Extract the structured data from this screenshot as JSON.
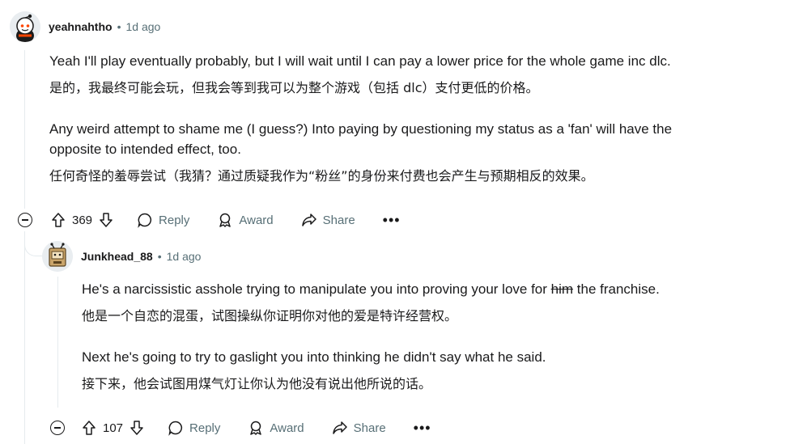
{
  "comments": [
    {
      "username": "yeahnahtho",
      "separator": "•",
      "time": "1d ago",
      "paragraphs": [
        "Yeah I'll play eventually probably, but I will wait until I can pay a lower price for the whole game inc dlc.",
        "是的，我最终可能会玩，但我会等到我可以为整个游戏（包括 dlc）支付更低的价格。",
        "Any weird attempt to shame me (I guess?) Into paying by questioning my status as a 'fan' will have the",
        "opposite to intended effect, too.",
        "任何奇怪的羞辱尝试（我猜？通过质疑我作为“粉丝”的身份来付费也会产生与预期相反的效果。"
      ],
      "votes": "369",
      "reply_label": "Reply",
      "award_label": "Award",
      "share_label": "Share",
      "more_label": "•••"
    },
    {
      "username": "Junkhead_88",
      "separator": "•",
      "time": "1d ago",
      "paragraph1_before": "He's a narcissistic asshole trying to manipulate you into proving your love for ",
      "paragraph1_strike": "him",
      "paragraph1_after": " the franchise.",
      "paragraphs": [
        "他是一个自恋的混蛋，试图操纵你证明你对他的爱是特许经营权。",
        "Next he's going to try to gaslight you into thinking he didn't say what he said.",
        "接下来，他会试图用煤气灯让你认为他没有说出他所说的话。"
      ],
      "votes": "107",
      "reply_label": "Reply",
      "award_label": "Award",
      "share_label": "Share",
      "more_label": "•••"
    }
  ],
  "colors": {
    "text": "#1a1a1b",
    "meta": "#576f76",
    "rail": "#e5ebee"
  },
  "icons": [
    "collapse-icon",
    "upvote-icon",
    "downvote-icon",
    "reply-bubble-icon",
    "award-icon",
    "share-arrow-icon",
    "more-icon"
  ]
}
